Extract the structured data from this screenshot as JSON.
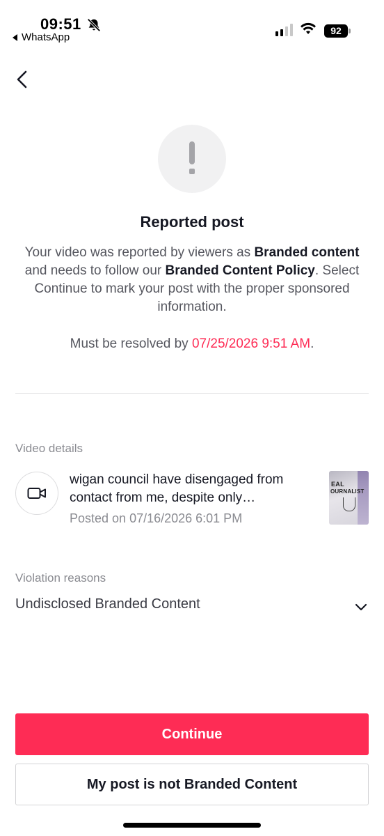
{
  "status_bar": {
    "time": "09:51",
    "back_app": "WhatsApp",
    "battery": "92"
  },
  "main": {
    "title": "Reported post",
    "description": {
      "p1": "Your video was reported by viewers as ",
      "b1": "Branded content",
      "p2": " and needs to follow our ",
      "b2": "Branded Content Policy",
      "p3": ". Select Continue to mark your post with the proper sponsored information."
    },
    "deadline_prefix": "Must be resolved by ",
    "deadline_value": "07/25/2026 9:51 AM",
    "deadline_suffix": "."
  },
  "video_details": {
    "label": "Video details",
    "title": "wigan council have disengaged from contact from me, despite only…",
    "posted": "Posted on 07/16/2026 6:01 PM",
    "thumb_text_1": "EAL",
    "thumb_text_2": "OURNALIST"
  },
  "violation": {
    "label": "Violation reasons",
    "value": "Undisclosed Branded Content"
  },
  "buttons": {
    "continue": "Continue",
    "not_branded": "My post is not Branded Content"
  },
  "colors": {
    "accent": "#fe2c55",
    "text_primary": "#161823",
    "text_secondary": "#8a8b91"
  },
  "icons": [
    "bell-slash-icon",
    "signal-icon",
    "wifi-icon",
    "battery-icon",
    "back-arrow-icon",
    "exclamation-icon",
    "video-camera-icon",
    "chevron-down-icon"
  ]
}
